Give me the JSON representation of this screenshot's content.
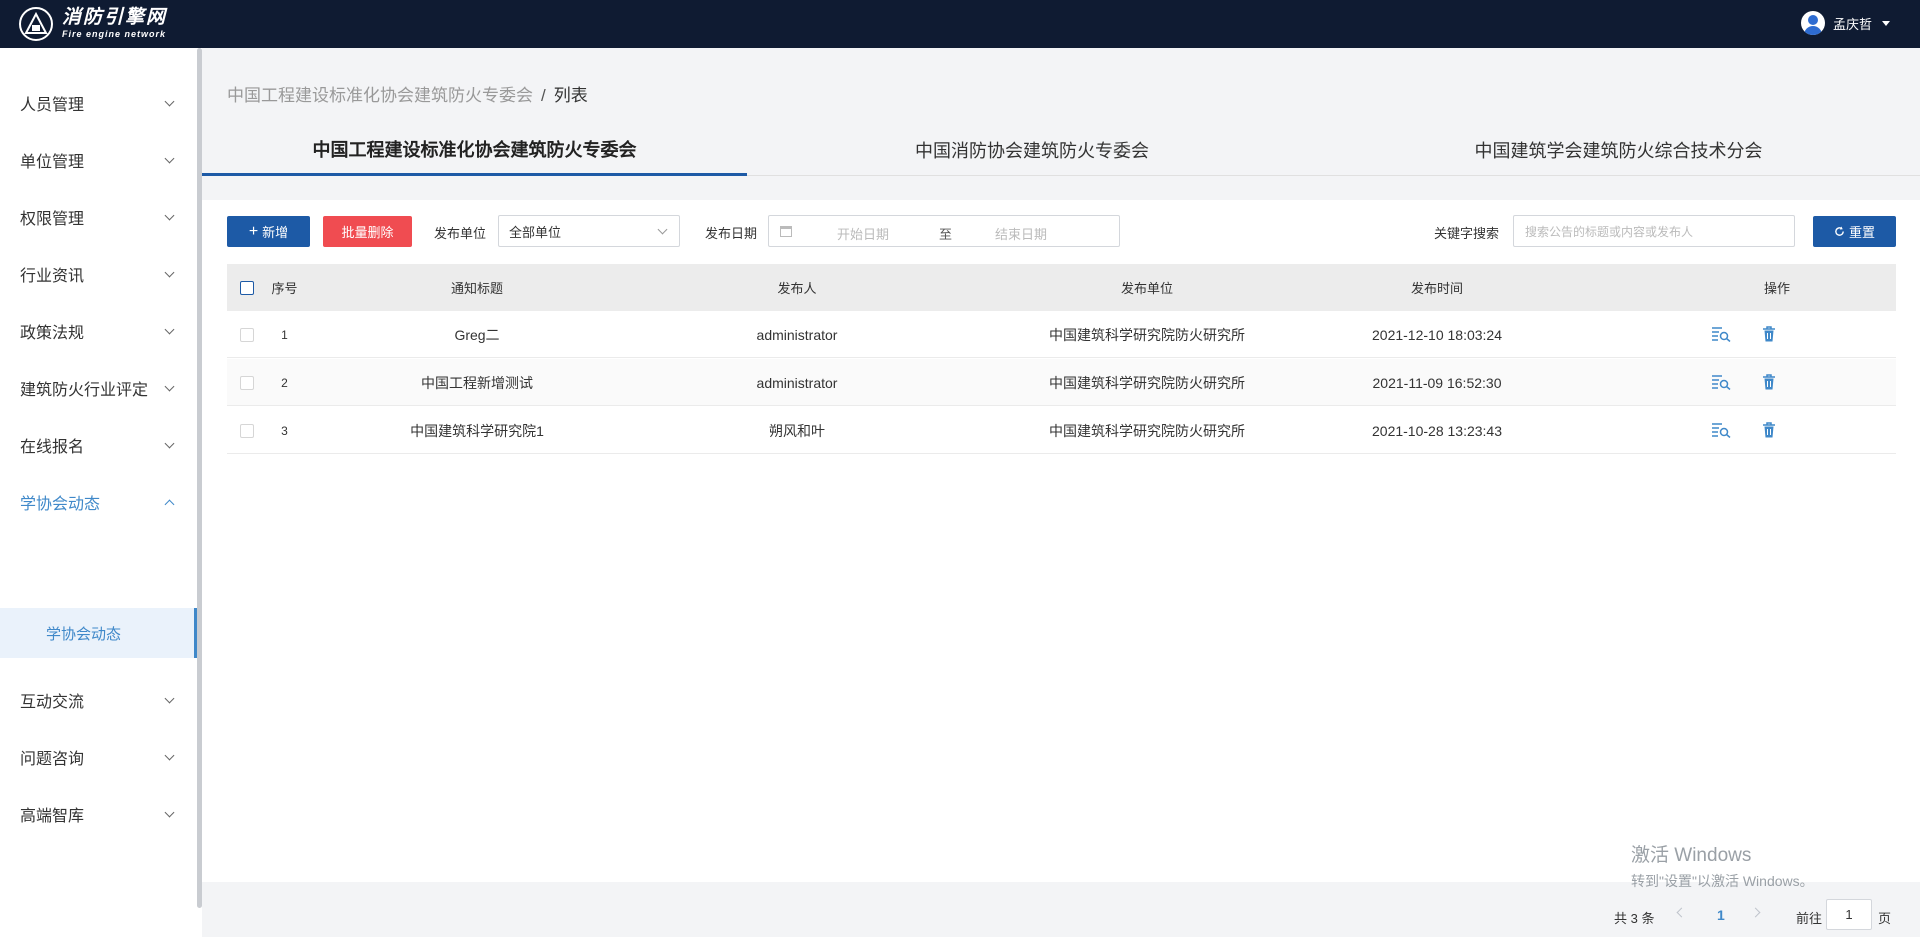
{
  "header": {
    "logo_title": "消防引擎网",
    "logo_subtitle": "Fire engine network",
    "user_name": "孟庆哲"
  },
  "sidebar": {
    "items": [
      {
        "label": "人员管理"
      },
      {
        "label": "单位管理"
      },
      {
        "label": "权限管理"
      },
      {
        "label": "行业资讯"
      },
      {
        "label": "政策法规"
      },
      {
        "label": "建筑防火行业评定"
      },
      {
        "label": "在线报名"
      },
      {
        "label": "学协会动态"
      },
      {
        "label": "互动交流"
      },
      {
        "label": "问题咨询"
      },
      {
        "label": "高端智库"
      }
    ],
    "open_item": "学协会动态",
    "sub_item": "学协会动态"
  },
  "breadcrumb": {
    "parent": "中国工程建设标准化协会建筑防火专委会",
    "separator": "/",
    "current": "列表"
  },
  "tabs": [
    {
      "label": "中国工程建设标准化协会建筑防火专委会",
      "active": true
    },
    {
      "label": "中国消防协会建筑防火专委会",
      "active": false
    },
    {
      "label": "中国建筑学会建筑防火综合技术分会",
      "active": false
    }
  ],
  "toolbar": {
    "add_label": "新增",
    "batch_delete_label": "批量删除",
    "unit_label": "发布单位",
    "unit_value": "全部单位",
    "date_label": "发布日期",
    "start_placeholder": "开始日期",
    "range_separator": "至",
    "end_placeholder": "结束日期",
    "keyword_label": "关键字搜索",
    "keyword_placeholder": "搜索公告的标题或内容或发布人",
    "reset_label": "重置"
  },
  "table": {
    "columns": [
      "序号",
      "通知标题",
      "发布人",
      "发布单位",
      "发布时间",
      "操作"
    ],
    "rows": [
      {
        "no": "1",
        "title": "Greg二",
        "publisher": "administrator",
        "unit": "中国建筑科学研究院防火研究所",
        "time": "2021-12-10 18:03:24"
      },
      {
        "no": "2",
        "title": "中国工程新增测试",
        "publisher": "administrator",
        "unit": "中国建筑科学研究院防火研究所",
        "time": "2021-11-09 16:52:30"
      },
      {
        "no": "3",
        "title": "中国建筑科学研究院1",
        "publisher": "朔风和叶",
        "unit": "中国建筑科学研究院防火研究所",
        "time": "2021-10-28 13:23:43"
      }
    ]
  },
  "pagination": {
    "total_text": "共 3 条",
    "current_page": "1",
    "goto_label": "前往",
    "goto_value": "1",
    "goto_suffix": "页"
  },
  "watermark": {
    "line1": "激活 Windows",
    "line2": "转到\"设置\"以激活 Windows。"
  },
  "colors": {
    "topbar": "#0f1b32",
    "primary": "#1d5aa6",
    "danger": "#f04c51",
    "active_nav": "#3f88c9"
  }
}
